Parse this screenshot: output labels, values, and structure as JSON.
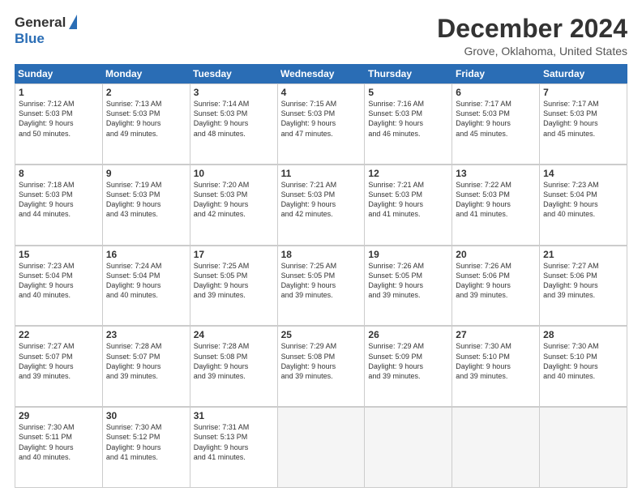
{
  "logo": {
    "general": "General",
    "blue": "Blue"
  },
  "title": "December 2024",
  "location": "Grove, Oklahoma, United States",
  "weekdays": [
    "Sunday",
    "Monday",
    "Tuesday",
    "Wednesday",
    "Thursday",
    "Friday",
    "Saturday"
  ],
  "weeks": [
    [
      {
        "day": "1",
        "info": "Sunrise: 7:12 AM\nSunset: 5:03 PM\nDaylight: 9 hours\nand 50 minutes."
      },
      {
        "day": "2",
        "info": "Sunrise: 7:13 AM\nSunset: 5:03 PM\nDaylight: 9 hours\nand 49 minutes."
      },
      {
        "day": "3",
        "info": "Sunrise: 7:14 AM\nSunset: 5:03 PM\nDaylight: 9 hours\nand 48 minutes."
      },
      {
        "day": "4",
        "info": "Sunrise: 7:15 AM\nSunset: 5:03 PM\nDaylight: 9 hours\nand 47 minutes."
      },
      {
        "day": "5",
        "info": "Sunrise: 7:16 AM\nSunset: 5:03 PM\nDaylight: 9 hours\nand 46 minutes."
      },
      {
        "day": "6",
        "info": "Sunrise: 7:17 AM\nSunset: 5:03 PM\nDaylight: 9 hours\nand 45 minutes."
      },
      {
        "day": "7",
        "info": "Sunrise: 7:17 AM\nSunset: 5:03 PM\nDaylight: 9 hours\nand 45 minutes."
      }
    ],
    [
      {
        "day": "8",
        "info": "Sunrise: 7:18 AM\nSunset: 5:03 PM\nDaylight: 9 hours\nand 44 minutes."
      },
      {
        "day": "9",
        "info": "Sunrise: 7:19 AM\nSunset: 5:03 PM\nDaylight: 9 hours\nand 43 minutes."
      },
      {
        "day": "10",
        "info": "Sunrise: 7:20 AM\nSunset: 5:03 PM\nDaylight: 9 hours\nand 42 minutes."
      },
      {
        "day": "11",
        "info": "Sunrise: 7:21 AM\nSunset: 5:03 PM\nDaylight: 9 hours\nand 42 minutes."
      },
      {
        "day": "12",
        "info": "Sunrise: 7:21 AM\nSunset: 5:03 PM\nDaylight: 9 hours\nand 41 minutes."
      },
      {
        "day": "13",
        "info": "Sunrise: 7:22 AM\nSunset: 5:03 PM\nDaylight: 9 hours\nand 41 minutes."
      },
      {
        "day": "14",
        "info": "Sunrise: 7:23 AM\nSunset: 5:04 PM\nDaylight: 9 hours\nand 40 minutes."
      }
    ],
    [
      {
        "day": "15",
        "info": "Sunrise: 7:23 AM\nSunset: 5:04 PM\nDaylight: 9 hours\nand 40 minutes."
      },
      {
        "day": "16",
        "info": "Sunrise: 7:24 AM\nSunset: 5:04 PM\nDaylight: 9 hours\nand 40 minutes."
      },
      {
        "day": "17",
        "info": "Sunrise: 7:25 AM\nSunset: 5:05 PM\nDaylight: 9 hours\nand 39 minutes."
      },
      {
        "day": "18",
        "info": "Sunrise: 7:25 AM\nSunset: 5:05 PM\nDaylight: 9 hours\nand 39 minutes."
      },
      {
        "day": "19",
        "info": "Sunrise: 7:26 AM\nSunset: 5:05 PM\nDaylight: 9 hours\nand 39 minutes."
      },
      {
        "day": "20",
        "info": "Sunrise: 7:26 AM\nSunset: 5:06 PM\nDaylight: 9 hours\nand 39 minutes."
      },
      {
        "day": "21",
        "info": "Sunrise: 7:27 AM\nSunset: 5:06 PM\nDaylight: 9 hours\nand 39 minutes."
      }
    ],
    [
      {
        "day": "22",
        "info": "Sunrise: 7:27 AM\nSunset: 5:07 PM\nDaylight: 9 hours\nand 39 minutes."
      },
      {
        "day": "23",
        "info": "Sunrise: 7:28 AM\nSunset: 5:07 PM\nDaylight: 9 hours\nand 39 minutes."
      },
      {
        "day": "24",
        "info": "Sunrise: 7:28 AM\nSunset: 5:08 PM\nDaylight: 9 hours\nand 39 minutes."
      },
      {
        "day": "25",
        "info": "Sunrise: 7:29 AM\nSunset: 5:08 PM\nDaylight: 9 hours\nand 39 minutes."
      },
      {
        "day": "26",
        "info": "Sunrise: 7:29 AM\nSunset: 5:09 PM\nDaylight: 9 hours\nand 39 minutes."
      },
      {
        "day": "27",
        "info": "Sunrise: 7:30 AM\nSunset: 5:10 PM\nDaylight: 9 hours\nand 39 minutes."
      },
      {
        "day": "28",
        "info": "Sunrise: 7:30 AM\nSunset: 5:10 PM\nDaylight: 9 hours\nand 40 minutes."
      }
    ],
    [
      {
        "day": "29",
        "info": "Sunrise: 7:30 AM\nSunset: 5:11 PM\nDaylight: 9 hours\nand 40 minutes."
      },
      {
        "day": "30",
        "info": "Sunrise: 7:30 AM\nSunset: 5:12 PM\nDaylight: 9 hours\nand 41 minutes."
      },
      {
        "day": "31",
        "info": "Sunrise: 7:31 AM\nSunset: 5:13 PM\nDaylight: 9 hours\nand 41 minutes."
      },
      {
        "day": "",
        "info": ""
      },
      {
        "day": "",
        "info": ""
      },
      {
        "day": "",
        "info": ""
      },
      {
        "day": "",
        "info": ""
      }
    ]
  ]
}
